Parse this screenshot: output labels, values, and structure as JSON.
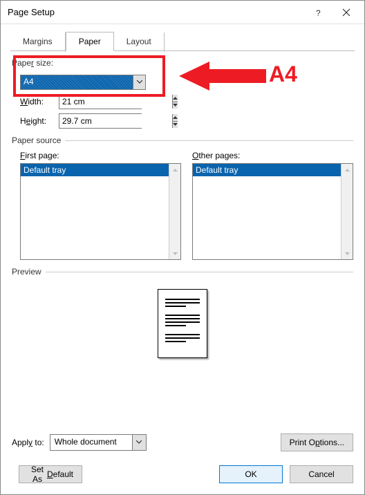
{
  "title": "Page Setup",
  "tabs": {
    "margins": "Margins",
    "paper": "Paper",
    "layout": "Layout"
  },
  "paper_size": {
    "legend": "Paper size:",
    "value": "A4",
    "width_label": "Width:",
    "width_value": "21 cm",
    "height_label": "Height:",
    "height_value": "29.7 cm"
  },
  "paper_source": {
    "legend": "Paper source",
    "first_label": "First page:",
    "other_label": "Other pages:",
    "first_items": [
      "Default tray"
    ],
    "other_items": [
      "Default tray"
    ]
  },
  "preview": {
    "legend": "Preview"
  },
  "apply": {
    "label": "Apply to:",
    "value": "Whole document"
  },
  "print_options": "Print Options...",
  "set_default": "Set As Default",
  "ok": "OK",
  "cancel": "Cancel",
  "annotation": {
    "text": "A4",
    "color": "#ed1c24"
  }
}
